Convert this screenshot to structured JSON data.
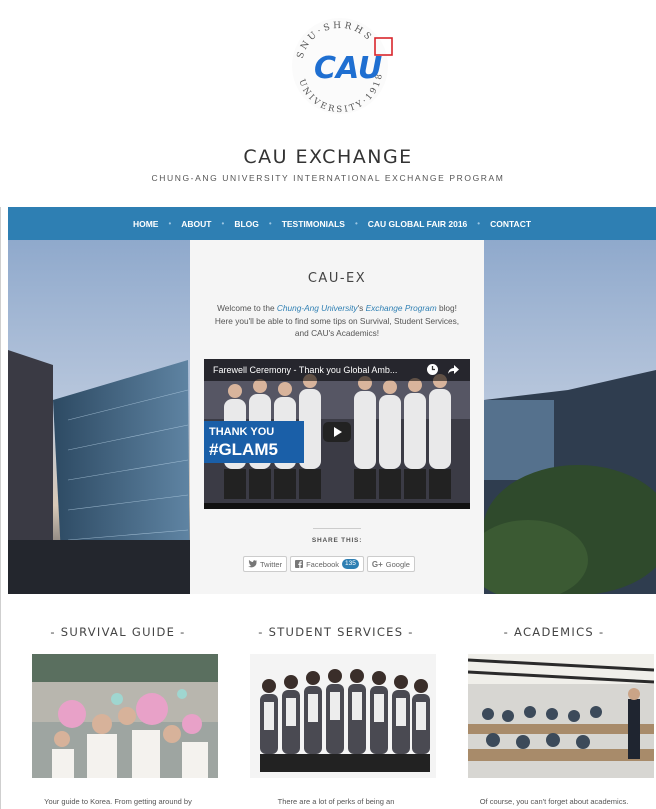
{
  "logo": {
    "arc_top": "SNU·SHRHS",
    "arc_bottom": "UNIVERSITY·1918",
    "wordmark": "CAU"
  },
  "site": {
    "title": "CAU EXCHANGE",
    "subtitle": "CHUNG-ANG UNIVERSITY INTERNATIONAL EXCHANGE PROGRAM"
  },
  "nav": {
    "items": [
      "HOME",
      "ABOUT",
      "BLOG",
      "TESTIMONIALS",
      "CAU GLOBAL FAIR 2016",
      "CONTACT"
    ],
    "separator": "•"
  },
  "hero": {
    "title": "CAU-EX",
    "intro": {
      "p1": "Welcome to the ",
      "link1": "Chung-Ang University",
      "p2": "'s ",
      "link2": "Exchange Program",
      "p3": " blog! Here you'll be able to find some tips on Survival, Student Services, and CAU's Academics!"
    },
    "video": {
      "title": "Farewell Ceremony - Thank you Global Amb...",
      "banner_line1": "THANK YOU",
      "banner_line2": "#GLAM5"
    },
    "share": {
      "label": "SHARE THIS:",
      "twitter": "Twitter",
      "facebook": "Facebook",
      "facebook_count": "135",
      "google": "Google"
    }
  },
  "features": [
    {
      "title": "- SURVIVAL GUIDE -",
      "text": "Your guide to Korea. From getting around by"
    },
    {
      "title": "- STUDENT SERVICES -",
      "text": "There are a lot of perks of being an"
    },
    {
      "title": "- ACADEMICS -",
      "text": "Of course, you can't forget about academics."
    }
  ],
  "colors": {
    "accent": "#2e7fb3",
    "logo_blue": "#1f6fd1",
    "logo_red": "#d9262c"
  }
}
